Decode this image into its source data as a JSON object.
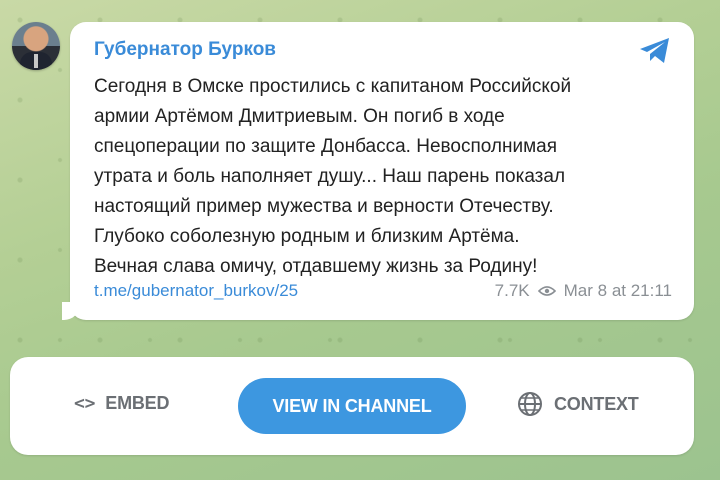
{
  "post": {
    "author": "Губернатор Бурков",
    "text": "Сегодня в Омске простились с капитаном Российской\nармии Артёмом Дмитриевым. Он погиб в ходе\nспецоперации по защите Донбасса. Невосполнимая\nутрата и боль наполняет душу... Наш парень показал\nнастоящий пример мужества и верности Отечеству.\nГлубоко соболезную родным и близким Артёма.\nВечная слава омичу, отдавшему жизнь за Родину!",
    "link": "t.me/gubernator_burkov/25",
    "views": "7.7K",
    "date": "Mar 8 at 21:11"
  },
  "actions": {
    "embed_icon": "<>",
    "embed_label": "EMBED",
    "view_label": "VIEW IN CHANNEL",
    "context_label": "CONTEXT"
  },
  "icons": {
    "telegram": "telegram-icon",
    "views": "eye-icon",
    "globe": "globe-icon"
  },
  "colors": {
    "accent": "#3a8bd8",
    "button": "#3d97e0",
    "meta": "#8a8f94"
  }
}
